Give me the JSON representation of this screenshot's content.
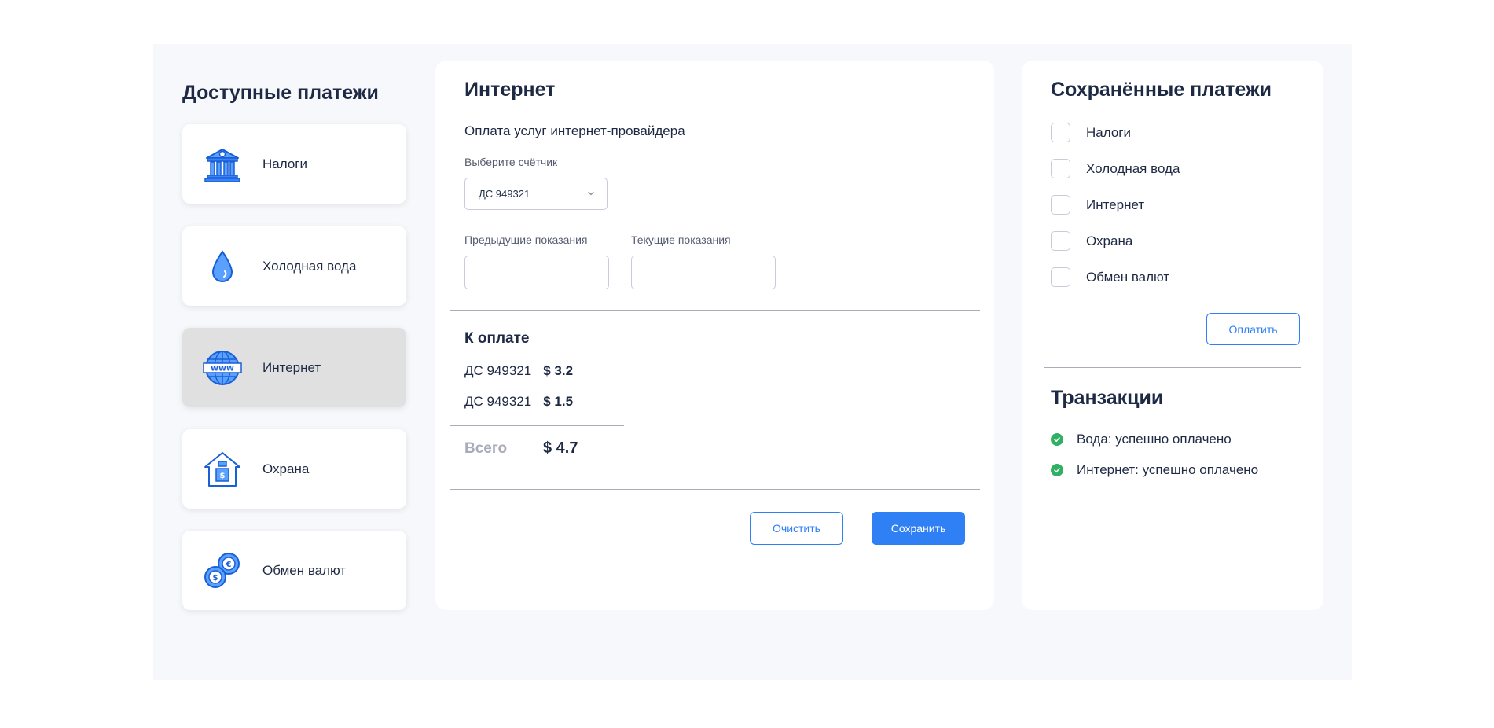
{
  "left": {
    "title": "Доступные платежи",
    "items": [
      {
        "label": "Налоги",
        "icon": "bank-icon",
        "active": false
      },
      {
        "label": "Холодная вода",
        "icon": "water-drop-icon",
        "active": false
      },
      {
        "label": "Интернет",
        "icon": "globe-www-icon",
        "active": true
      },
      {
        "label": "Охрана",
        "icon": "house-security-icon",
        "active": false
      },
      {
        "label": "Обмен валют",
        "icon": "coins-icon",
        "active": false
      }
    ]
  },
  "center": {
    "title": "Интернет",
    "subtitle": "Оплата услуг интернет-провайдера",
    "meter_label": "Выберите счётчик",
    "meter_selected": "ДС 949321",
    "prev_label": "Предыдущие показания",
    "prev_value": "",
    "curr_label": "Текущие показания",
    "curr_value": "",
    "due_title": "К оплате",
    "due_lines": [
      {
        "meter": "ДС 949321",
        "amount": "$ 3.2"
      },
      {
        "meter": "ДС 949321",
        "amount": "$ 1.5"
      }
    ],
    "total_label": "Всего",
    "total_value": "$ 4.7",
    "clear_label": "Очистить",
    "save_label": "Сохранить"
  },
  "right": {
    "saved_title": "Сохранённые платежи",
    "saved_items": [
      {
        "label": "Налоги",
        "checked": false
      },
      {
        "label": "Холодная вода",
        "checked": false
      },
      {
        "label": "Интернет",
        "checked": false
      },
      {
        "label": "Охрана",
        "checked": false
      },
      {
        "label": "Обмен валют",
        "checked": false
      }
    ],
    "pay_label": "Оплатить",
    "tx_title": "Транзакции",
    "transactions": [
      {
        "text": "Вода: успешно оплачено",
        "status": "success"
      },
      {
        "text": "Интернет: успешно оплачено",
        "status": "success"
      }
    ]
  },
  "colors": {
    "accent": "#2f80f5",
    "success": "#2fb163",
    "text": "#1e2a44",
    "muted": "#a7acb8",
    "active_item": "#e0e0e0",
    "background": "#f7f8fb"
  }
}
